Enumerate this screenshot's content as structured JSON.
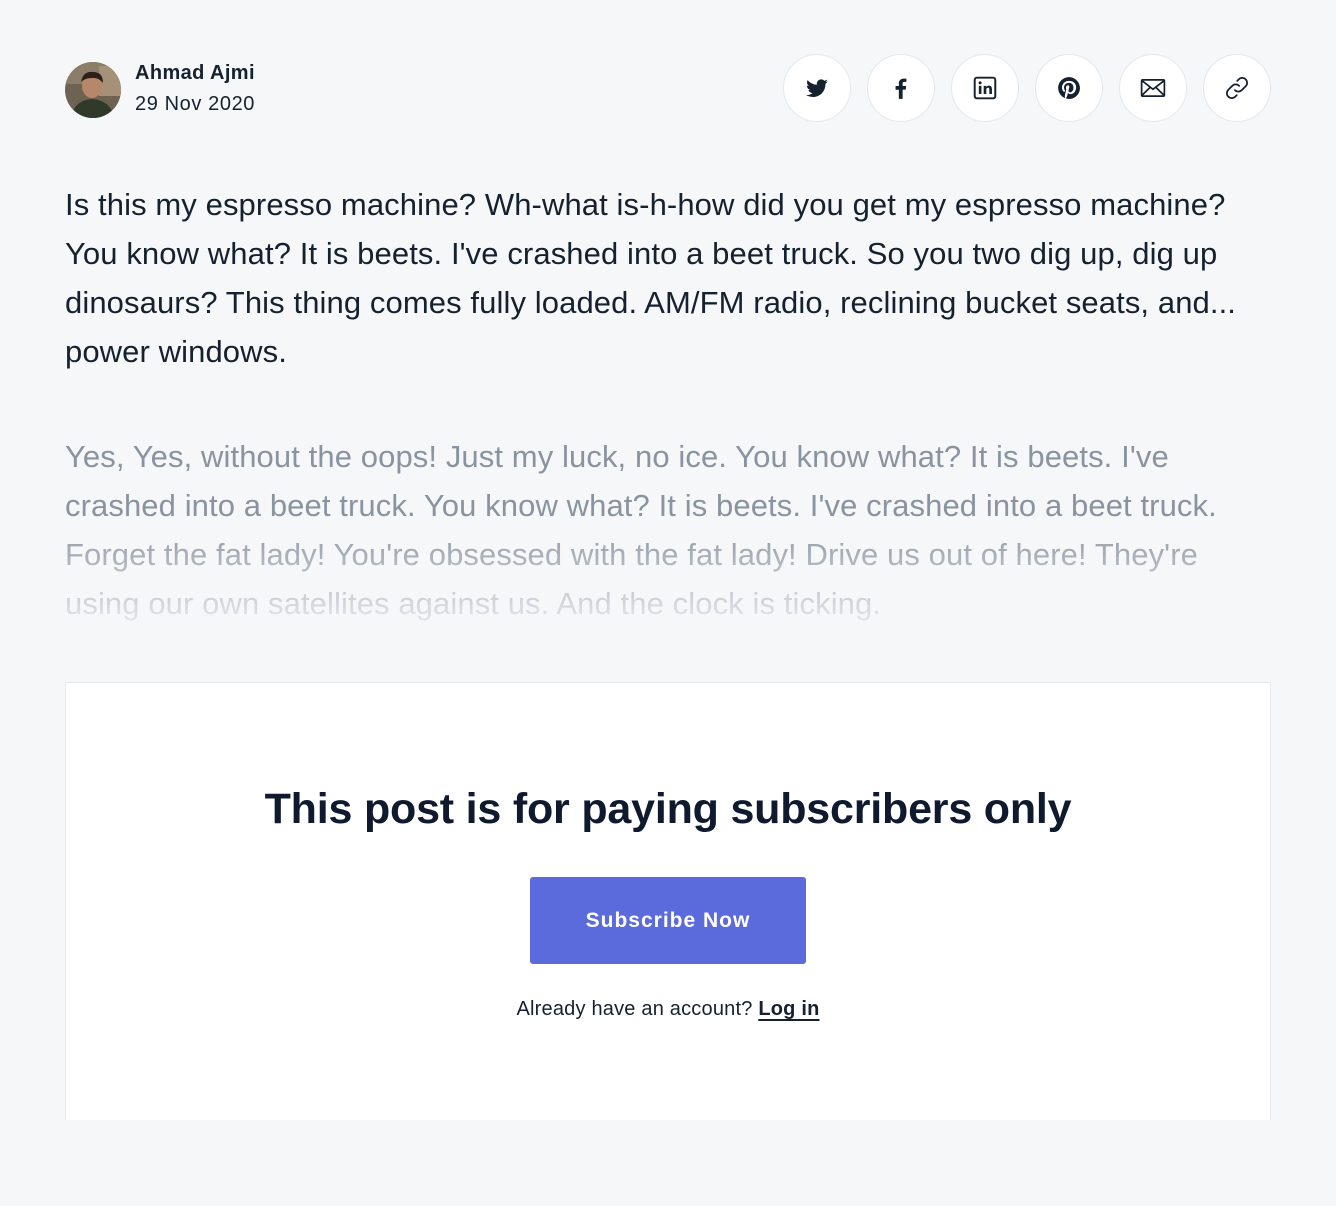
{
  "author": {
    "name": "Ahmad Ajmi",
    "date": "29 Nov 2020"
  },
  "share": {
    "icons": [
      "twitter-icon",
      "facebook-icon",
      "linkedin-icon",
      "pinterest-icon",
      "email-icon",
      "link-icon"
    ]
  },
  "post": {
    "paragraph_1": "Is this my espresso machine? Wh-what is-h-how did you get my espresso machine? You know what? It is beets. I've crashed into a beet truck. So you two dig up, dig up dinosaurs? This thing comes fully loaded. AM/FM radio, reclining bucket seats, and... power windows.",
    "paragraph_2": "Yes, Yes, without the oops! Just my luck, no ice. You know what? It is beets. I've crashed into a beet truck. You know what? It is beets. I've crashed into a beet truck. Forget the fat lady! You're obsessed with the fat lady! Drive us out of here! They're using our own satellites against us. And the clock is ticking."
  },
  "paywall": {
    "title": "This post is for paying subscribers only",
    "subscribe_label": "Subscribe Now",
    "account_prompt": "Already have an account?",
    "login_label": "Log in"
  },
  "colors": {
    "background": "#f6f7f9",
    "text": "#15212e",
    "faded_text": "#8a93a0",
    "accent": "#5b6bdc",
    "card": "#ffffff"
  }
}
